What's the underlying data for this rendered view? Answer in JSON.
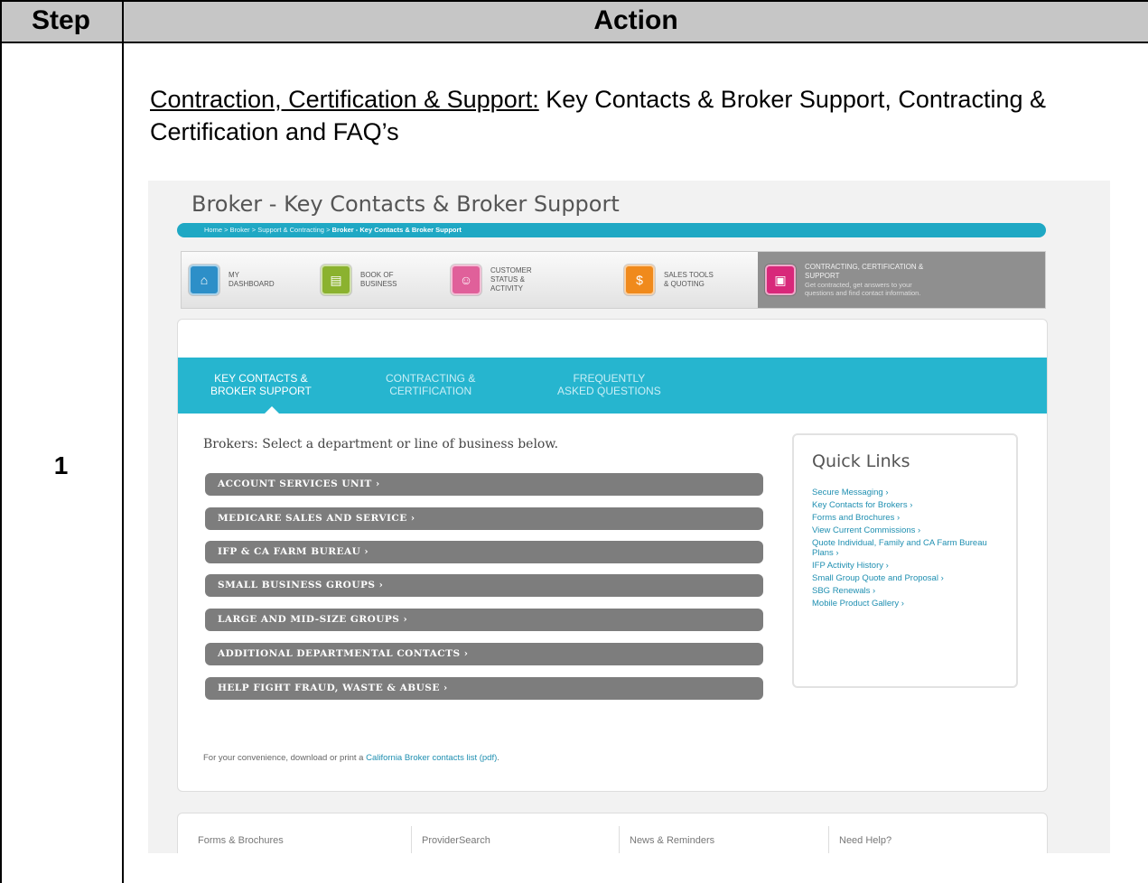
{
  "table": {
    "header_step": "Step",
    "header_action": "Action",
    "step_number": "1"
  },
  "instruction": {
    "underlined": "Contraction, Certification & Support:",
    "rest": " Key Contacts & Broker Support, Contracting & Certification and FAQ’s"
  },
  "screenshot": {
    "page_title": "Broker - Key Contacts & Broker Support",
    "breadcrumb_prefix": "Home > Broker > Support & Contracting > ",
    "breadcrumb_current": "Broker - Key Contacts & Broker Support",
    "nav": [
      {
        "label": "MY\nDASHBOARD",
        "icon": "dashboard-icon",
        "color": "#2d8fc8"
      },
      {
        "label": "BOOK OF\nBUSINESS",
        "icon": "book-icon",
        "color": "#8bb22f"
      },
      {
        "label": "CUSTOMER\nSTATUS &\nACTIVITY",
        "icon": "customer-icon",
        "color": "#e0609a"
      },
      {
        "label": "SALES TOOLS\n& QUOTING",
        "icon": "sales-icon",
        "color": "#f08a1c"
      },
      {
        "label": "CONTRACTING, CERTIFICATION &\nSUPPORT",
        "sub": "Get contracted, get answers to your\nquestions and find contact information.",
        "icon": "contracting-icon",
        "color": "#d8287a"
      }
    ],
    "tabs": [
      "KEY CONTACTS &\nBROKER SUPPORT",
      "CONTRACTING &\nCERTIFICATION",
      "FREQUENTLY\nASKED QUESTIONS"
    ],
    "select_label": "Brokers: Select a department or line of business below.",
    "departments": [
      "ACCOUNT SERVICES UNIT ›",
      "MEDICARE SALES AND SERVICE ›",
      "IFP & CA FARM BUREAU ›",
      "SMALL BUSINESS GROUPS ›",
      "LARGE AND MID-SIZE GROUPS ›",
      "ADDITIONAL DEPARTMENTAL CONTACTS ›",
      "HELP FIGHT FRAUD, WASTE & ABUSE ›"
    ],
    "quick_links_title": "Quick Links",
    "quick_links": [
      "Secure Messaging ›",
      "Key Contacts for Brokers ›",
      "Forms and Brochures ›",
      "View Current Commissions ›",
      "Quote Individual, Family and CA Farm Bureau Plans ›",
      "IFP Activity History ›",
      "Small Group Quote and Proposal ›",
      "SBG Renewals ›",
      "Mobile Product Gallery ›"
    ],
    "note_prefix": "For your convenience, download or print a ",
    "note_link": "California Broker contacts list (pdf)",
    "note_suffix": ".",
    "footer": [
      "Forms & Brochures",
      "ProviderSearch",
      "News & Reminders",
      "Need Help?"
    ]
  }
}
